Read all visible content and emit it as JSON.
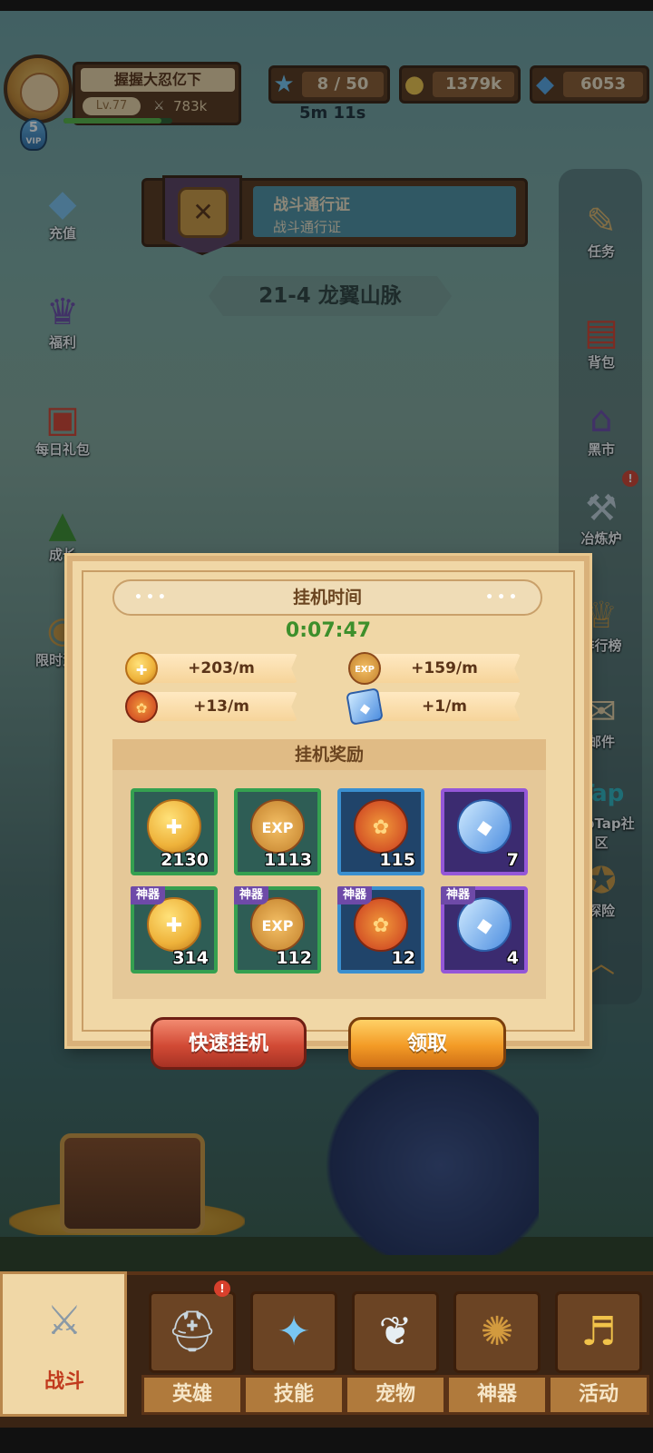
{
  "player": {
    "name": "握握大忍亿下",
    "level": "Lv.77",
    "power": "783k",
    "vip_level": "5",
    "vip_text": "VIP"
  },
  "resources": {
    "stamina": "8 / 50",
    "stamina_timer": "5m 11s",
    "gold": "1379k",
    "gems": "6053"
  },
  "battle_pass": {
    "title": "战斗通行证",
    "subtitle": "战斗通行证"
  },
  "stage": "21-4 龙翼山脉",
  "left_menu": [
    {
      "label": "充值",
      "icon": "gem-pile-icon"
    },
    {
      "label": "福利",
      "icon": "welfare-icon"
    },
    {
      "label": "每日礼包",
      "icon": "gift-box-icon"
    },
    {
      "label": "成长",
      "icon": "growth-icon"
    },
    {
      "label": "限时活动",
      "icon": "limited-event-icon"
    }
  ],
  "right_menu": [
    {
      "label": "任务",
      "icon": "scroll-quest-icon"
    },
    {
      "label": "背包",
      "icon": "backpack-icon"
    },
    {
      "label": "黑市",
      "icon": "black-market-icon"
    },
    {
      "label": "冶炼炉",
      "icon": "anvil-icon"
    },
    {
      "label": "排行榜",
      "icon": "ranking-trophy-icon"
    },
    {
      "label": "邮件",
      "icon": "mail-icon"
    },
    {
      "label": "TapTap社区",
      "icon": "taptap-icon"
    },
    {
      "label": "探险",
      "icon": "explore-compass-icon"
    }
  ],
  "idle_dialog": {
    "time_title": "挂机时间",
    "elapsed": "0:07:47",
    "rates": [
      {
        "value": "+203/m",
        "icon": "gold-coin-icon"
      },
      {
        "value": "+159/m",
        "icon": "exp-badge-icon"
      },
      {
        "value": "+13/m",
        "icon": "pet-medal-icon"
      },
      {
        "value": "+1/m",
        "icon": "blue-crystal-icon"
      }
    ],
    "rewards_title": "挂机奖励",
    "rewards": [
      {
        "count": "2130",
        "icon": "gold-coin-icon",
        "tag": ""
      },
      {
        "count": "1113",
        "icon": "exp-badge-icon",
        "tag": ""
      },
      {
        "count": "115",
        "icon": "pet-medal-icon",
        "tag": ""
      },
      {
        "count": "7",
        "icon": "blue-crystal-icon",
        "tag": ""
      },
      {
        "count": "314",
        "icon": "gold-coin-icon",
        "tag": "神器"
      },
      {
        "count": "112",
        "icon": "exp-badge-icon",
        "tag": "神器"
      },
      {
        "count": "12",
        "icon": "pet-medal-icon",
        "tag": "神器"
      },
      {
        "count": "4",
        "icon": "blue-crystal-icon",
        "tag": "神器"
      }
    ],
    "quick_idle_label": "快速挂机",
    "claim_label": "领取"
  },
  "bottom_nav": [
    {
      "label": "战斗",
      "icon": "crossed-swords-icon",
      "active": true
    },
    {
      "label": "英雄",
      "icon": "knight-helmet-icon",
      "active": false
    },
    {
      "label": "技能",
      "icon": "spell-book-icon",
      "active": false
    },
    {
      "label": "宠物",
      "icon": "wings-icon",
      "active": false
    },
    {
      "label": "神器",
      "icon": "artifact-icon",
      "active": false
    },
    {
      "label": "活动",
      "icon": "event-horn-icon",
      "active": false
    }
  ],
  "colors": {
    "elapsed_time": "#3d8f2b",
    "quick_idle_button": "#d24a35",
    "claim_button": "#f39b26",
    "active_tab_label": "#c13a1e"
  }
}
